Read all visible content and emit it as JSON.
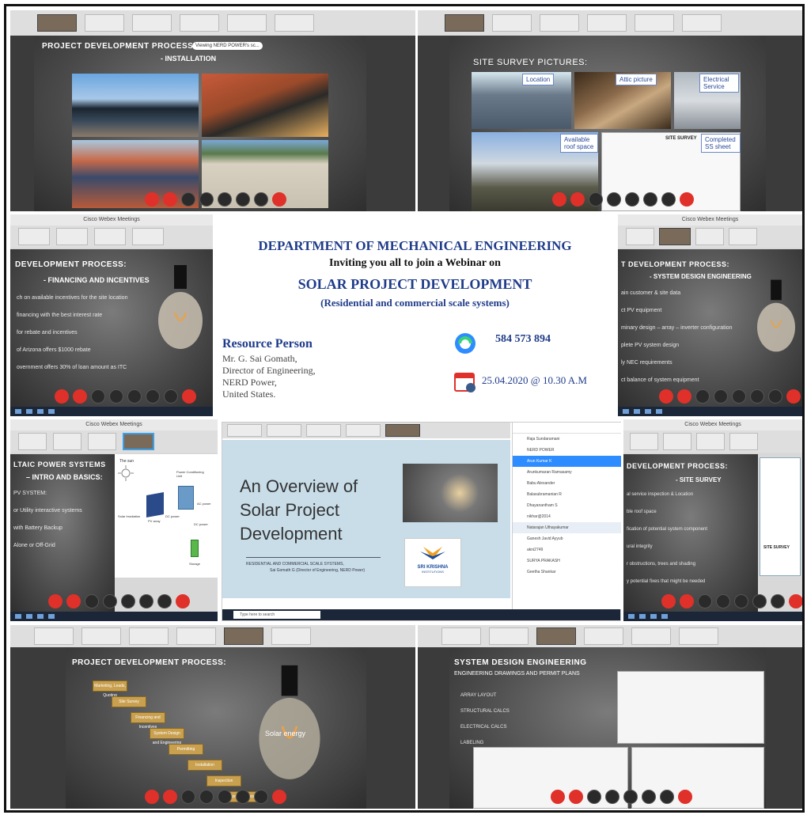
{
  "colors": {
    "heading": "#1f3c8a",
    "accent_red": "#e0302a",
    "zoom_blue": "#2d8cff"
  },
  "p1": {
    "title": "PROJECT DEVELOPMENT PROCESS",
    "subtitle": "- INSTALLATION",
    "badge": "Viewing NERD POWER's sc..."
  },
  "p2": {
    "title": "SITE SURVEY PICTURES:",
    "labels": [
      "Location",
      "Attic picture",
      "Electrical Service",
      "Available roof space",
      "Completed SS sheet"
    ],
    "sheet_title": "SITE SURVEY"
  },
  "p3": {
    "title": "DEVELOPMENT PROCESS:",
    "subtitle": "- FINANCING AND INCENTIVES",
    "bullets": [
      "ch on available incentives for the site location",
      "financing with the best interest rate",
      "for rebate and incentives",
      "of Arizona offers $1000 rebate",
      "overnment offers 30% of loan amount as ITC"
    ],
    "window_title": "Cisco Webex Meetings"
  },
  "poster": {
    "dept": "DEPARTMENT OF MECHANICAL ENGINEERING",
    "invite": "Inviting you all to join a Webinar on",
    "topic": "SOLAR PROJECT DEVELOPMENT",
    "scope": "(Residential and commercial scale systems)",
    "rp_label": "Resource Person",
    "rp_name": "Mr. G. Sai Gomath,",
    "rp_role": "Director of Engineering,",
    "rp_org": "NERD Power,",
    "rp_country": "United States.",
    "meeting_id": "584 573 894",
    "datetime": "25.04.2020 @ 10.30 A.M"
  },
  "p4": {
    "title": "T DEVELOPMENT PROCESS:",
    "subtitle": "- SYSTEM DESIGN ENGINEERING",
    "bullets": [
      "ain customer & site data",
      "ct PV equipment",
      "minary design – array – inverter configuration",
      "plete PV system design",
      "ly NEC requirements",
      "ct balance of system equipment"
    ],
    "window_title": "Cisco Webex Meetings"
  },
  "p5": {
    "title": "LTAIC POWER SYSTEMS",
    "subtitle": "– INTRO AND BASICS:",
    "bullets": [
      "PV SYSTEM:",
      "or Utility interactive systems",
      "with Battery Backup",
      "Alone or Off-Grid"
    ],
    "diagram": [
      "The sun",
      "Solar Irradiation",
      "PV array",
      "Power Conditioning Unit",
      "DC power",
      "AC power",
      "DC power",
      "Storage"
    ],
    "window_title": "Cisco Webex Meetings"
  },
  "ov": {
    "title_l1": "An Overview of",
    "title_l2": "Solar Project",
    "title_l3": "Development",
    "sub1": "RESIDENTIAL AND COMMERCIAL SCALE SYSTEMS,",
    "sub2": "Sai Gomath G (Director of Engineering, NERD Power)",
    "logo": "SRI KRISHNA",
    "logo_sub": "INSTITUTIONS",
    "search": "Type here to search",
    "participants": [
      "Raja Sundaramani",
      "NERD POWER",
      "Arun Kumar K",
      "Arunkumaran Ramasamy",
      "Babu Alexander",
      "Balasubramanian R",
      "Dhayanantham S",
      "nikhar@2014",
      "Natarajan Uthayakumar",
      "Ganesh Javid Ayyub",
      "akni2749",
      "SURYA PRAKASH",
      "Geetha Shankar"
    ]
  },
  "p6": {
    "title": "DEVELOPMENT PROCESS:",
    "subtitle": "- SITE SURVEY",
    "bullets": [
      "al service inspection & Location",
      "ble roof space",
      "fication of potential system component",
      "ural integrity",
      "r obstructions, trees and shading",
      "y potential fixes that might be needed"
    ],
    "sheet_title": "SITE SURVEY",
    "window_title": "Cisco Webex Meetings"
  },
  "p7": {
    "title": "PROJECT DEVELOPMENT PROCESS:",
    "steps": [
      "Marketing, Leads, Quoting",
      "Site Survey",
      "Financing and Incentives",
      "System Design and Engineering",
      "Permitting",
      "Installation",
      "Inspection",
      "Commissioning"
    ],
    "bulb_text": "Solar energy"
  },
  "p8": {
    "title": "SYSTEM DESIGN ENGINEERING",
    "subtitle": "ENGINEERING DRAWINGS AND PERMIT PLANS",
    "bullets": [
      "ARRAY LAYOUT",
      "STRUCTURAL CALCS",
      "ELECTRICAL CALCS",
      "LABELING"
    ]
  }
}
